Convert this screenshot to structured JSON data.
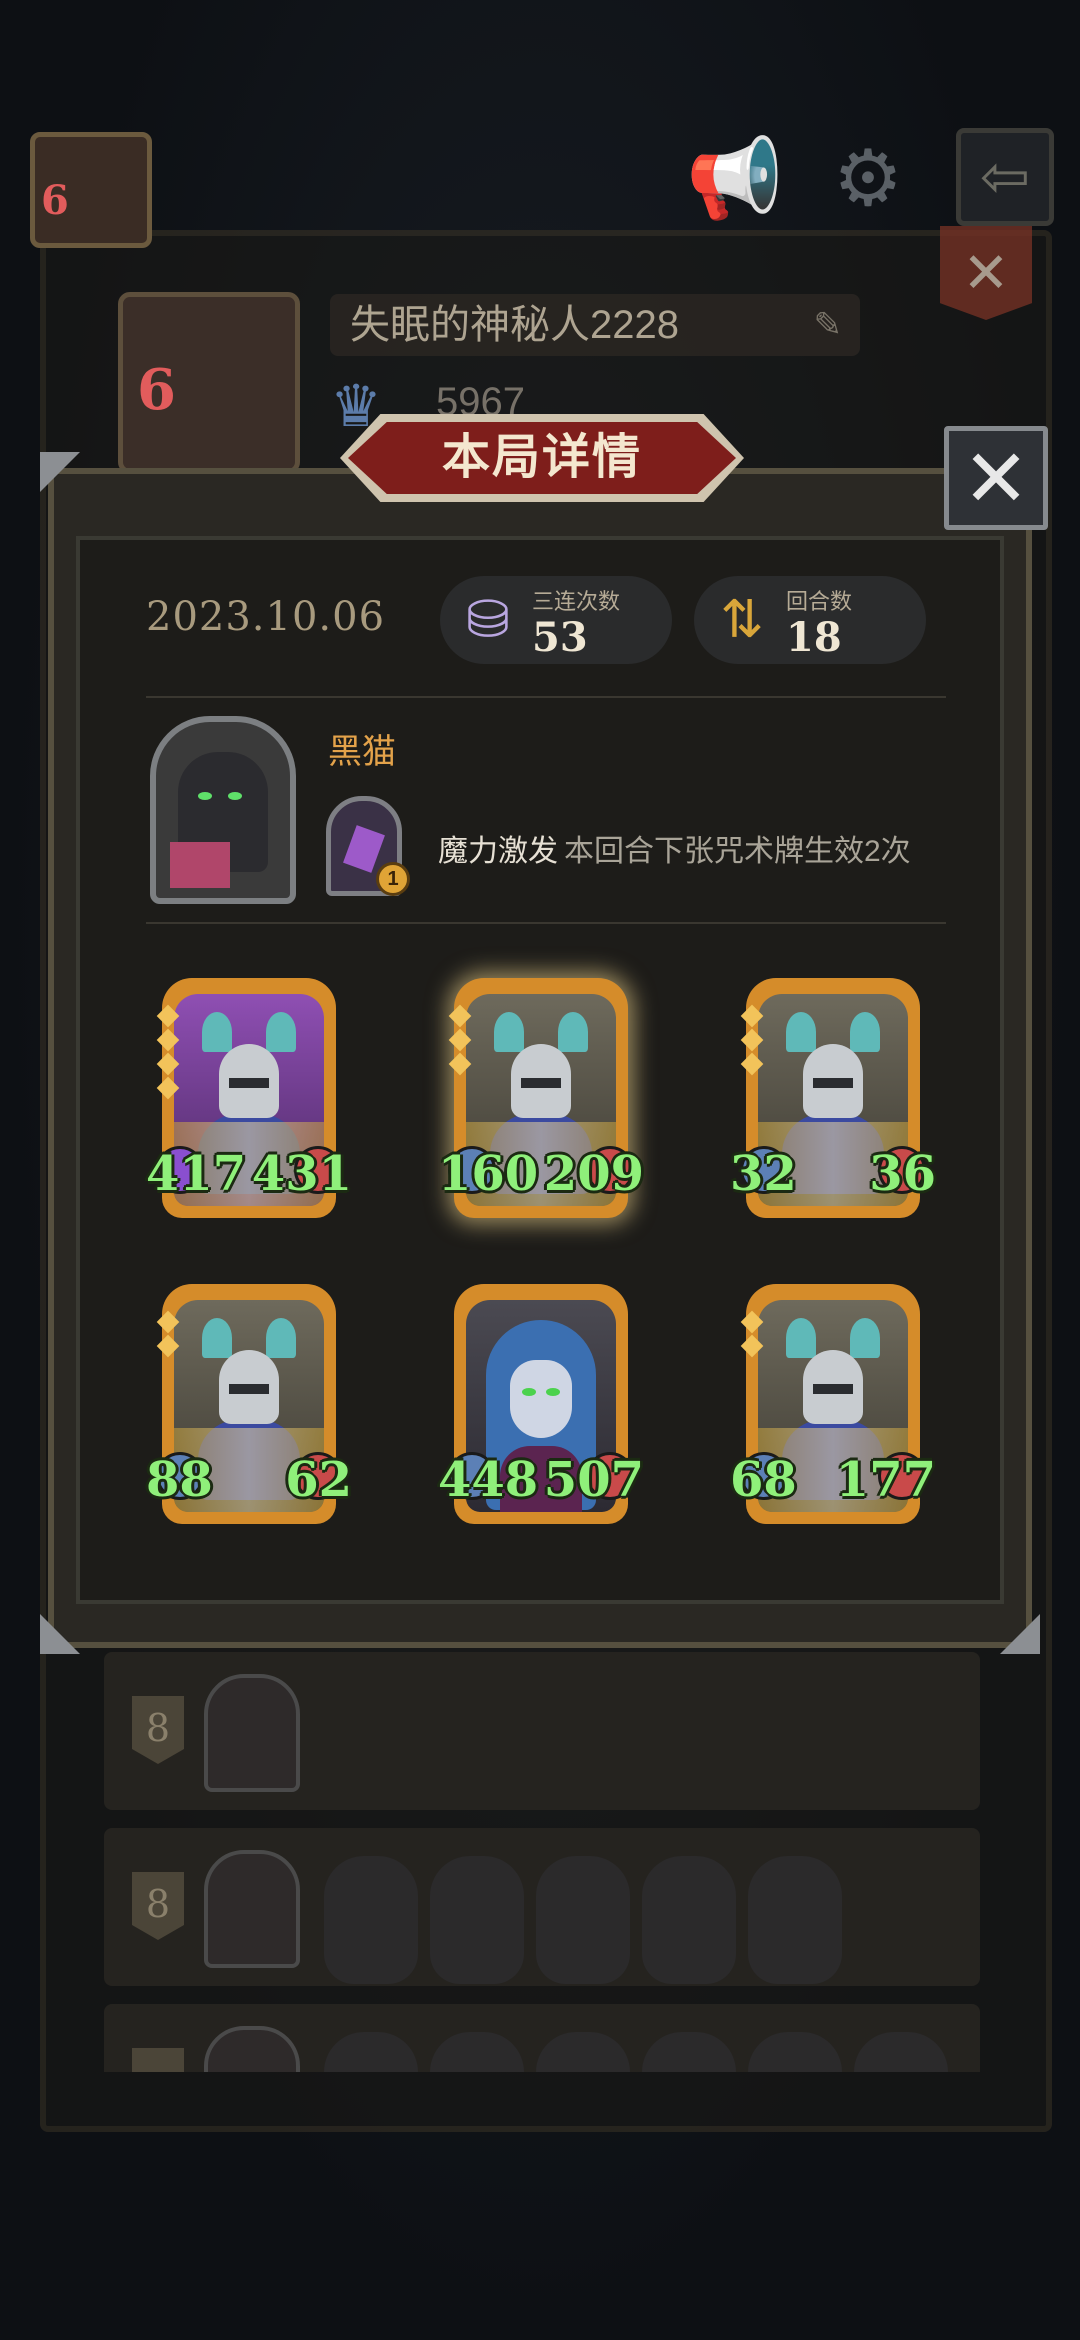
{
  "background": {
    "player": {
      "avatar_level": "6",
      "name": "失眠的神秘人2228",
      "trophies": "5967"
    },
    "icons": [
      "megaphone-icon",
      "gear-icon",
      "exit-icon",
      "close-icon"
    ],
    "list": [
      {
        "rank": "8"
      },
      {
        "rank": "8"
      },
      {
        "rank": ""
      }
    ]
  },
  "dialog": {
    "title": "本局详情",
    "close_label": "✕",
    "date": "2023.10.06",
    "stats": [
      {
        "label": "三连次数",
        "value": "53",
        "icon": "triple-icon"
      },
      {
        "label": "回合数",
        "value": "18",
        "icon": "rounds-icon"
      }
    ],
    "hero": {
      "name": "黑猫",
      "skill_level": "1",
      "skill_name": "魔力激发",
      "skill_desc": "本回合下张咒术牌生效2次"
    },
    "units": [
      {
        "attack": "417",
        "health": "431"
      },
      {
        "attack": "160",
        "health": "209"
      },
      {
        "attack": "32",
        "health": "36"
      },
      {
        "attack": "88",
        "health": "62"
      },
      {
        "attack": "448",
        "health": "507"
      },
      {
        "attack": "68",
        "health": "177"
      }
    ]
  },
  "colors": {
    "accent_gold": "#e3a24a",
    "banner_red": "#7e1e1b",
    "stat_green": "#8ff07a"
  }
}
